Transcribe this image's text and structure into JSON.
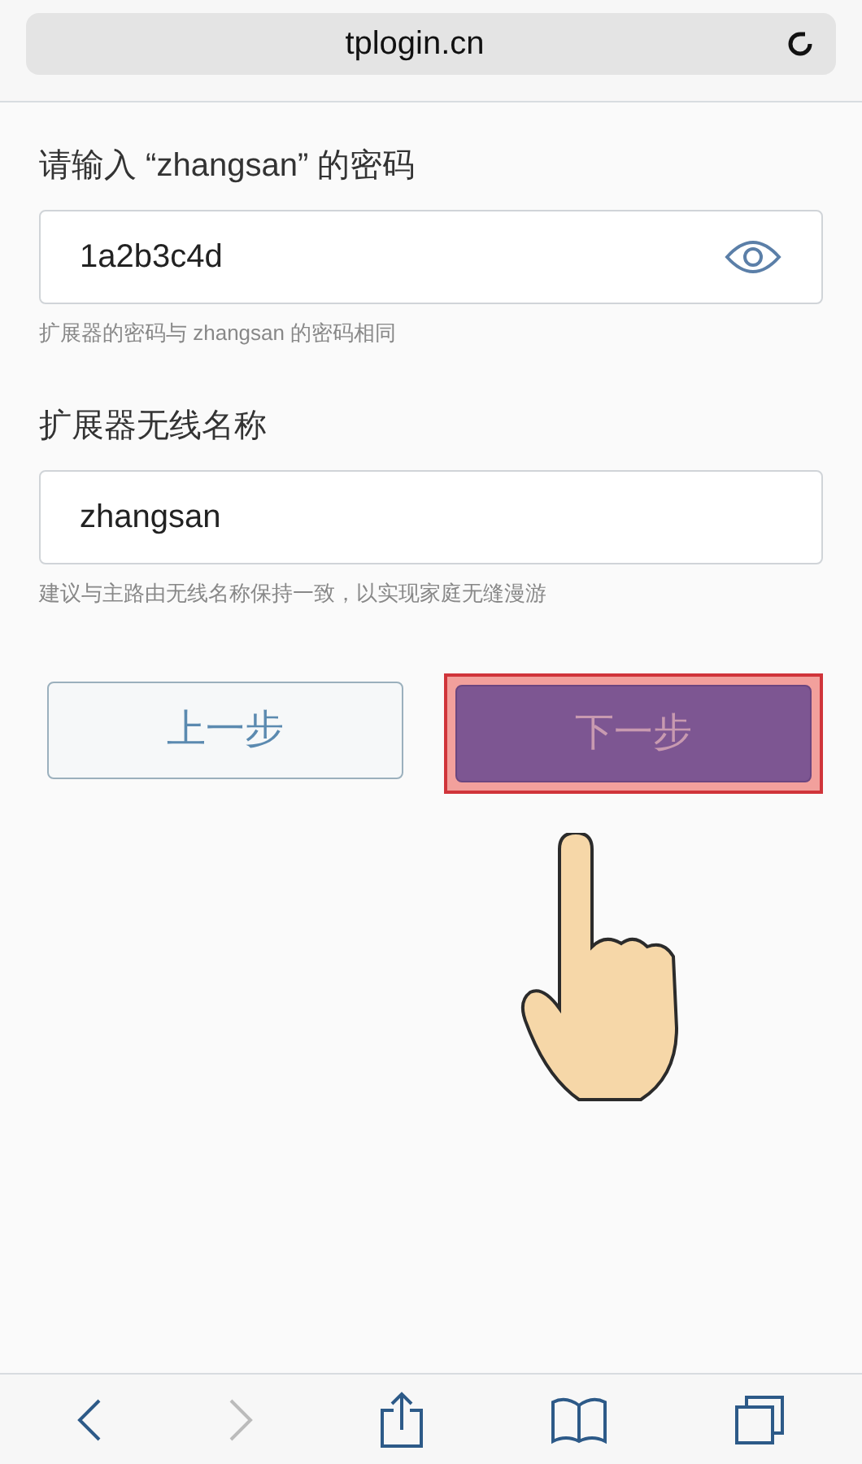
{
  "address_bar": {
    "url": "tplogin.cn"
  },
  "password_section": {
    "label": "请输入 “zhangsan” 的密码",
    "value": "1a2b3c4d",
    "hint": "扩展器的密码与 zhangsan 的密码相同"
  },
  "ssid_section": {
    "label": "扩展器无线名称",
    "value": "zhangsan",
    "hint": "建议与主路由无线名称保持一致，以实现家庭无缝漫游"
  },
  "buttons": [
    {
      "kind": "secondary",
      "label": "上一步",
      "highlighted": false,
      "disabled": false
    },
    {
      "kind": "primary",
      "label": "下一步",
      "highlighted": true,
      "disabled": true
    }
  ],
  "toolbar": {
    "forward_disabled": true
  }
}
